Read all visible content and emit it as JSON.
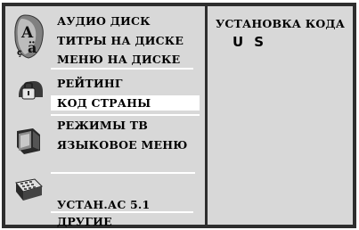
{
  "menu": {
    "group1": [
      "АУДИО ДИСК",
      "ТИТРЫ НА ДИСКЕ",
      "МЕНЮ НА ДИСКЕ"
    ],
    "group2": [
      "РЕЙТИНГ",
      "КОД СТРАНЫ"
    ],
    "group3": [
      "РЕЖИМЫ ТВ",
      "ЯЗЫКОВОЕ МЕНЮ"
    ],
    "group4": [
      "УСТАН.АС 5.1"
    ],
    "group5": [
      "ДРУГИЕ"
    ],
    "selected": "КОД СТРАНЫ"
  },
  "right": {
    "title": "УСТАНОВКА КОДА",
    "code_chars": [
      "U",
      "S"
    ]
  },
  "colors": {
    "frame": "#2e2e2e",
    "panel": "#d8d8d8",
    "highlight": "#ffffff"
  }
}
